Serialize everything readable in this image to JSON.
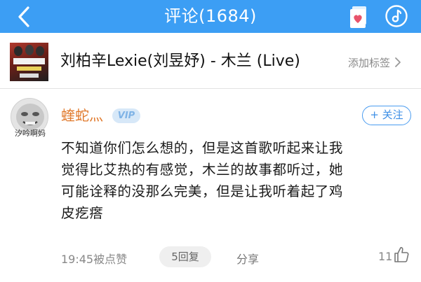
{
  "header": {
    "title": "评论(1684)"
  },
  "song": {
    "title": "刘柏辛Lexie(刘昱妤) - 木兰 (Live)",
    "add_tag_label": "添加标签"
  },
  "comment": {
    "username": "蝰蛇灬",
    "vip_label": "VIP",
    "avatar_caption": "汐吟啊妈",
    "follow_label": "+ 关注",
    "lines": [
      "不知道你们怎么想的，但是这首歌听起来让我",
      "觉得比艾热的有感觉，木兰的故事都听过，她",
      "可能诠释的没那么完美，但是让我听着起了鸡",
      "皮疙瘩"
    ],
    "timestamp": "19:45被点赞",
    "reply_label": "5回复",
    "share_label": "分享",
    "like_count": "11"
  },
  "colors": {
    "header_bg": "#3c9ef4",
    "username": "#e0782a",
    "follow_accent": "#3d8fe6"
  }
}
